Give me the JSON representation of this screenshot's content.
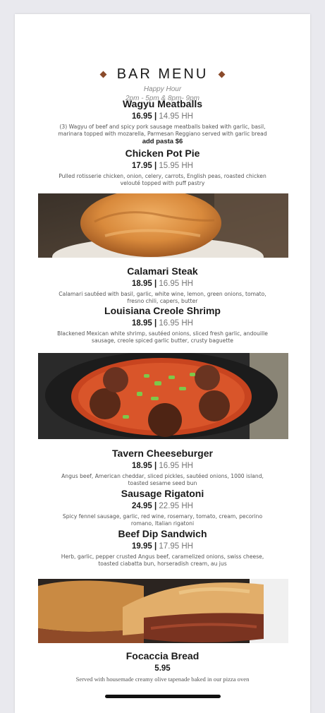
{
  "menu": {
    "title": "BAR MENU",
    "happy_hour_label": "Happy Hour",
    "happy_hour_times": "2pm - 5pm & 8pm- 9pm"
  },
  "items": [
    {
      "name": "Wagyu Meatballs",
      "price": "16.95",
      "separator": "|",
      "hh_price": "14.95 HH",
      "description": "(3) Wagyu of beef and spicy pork sausage meatballs baked with garlic, basil, marinara topped with mozarella, Parmesan Reggiano served with garlic bread",
      "extra": "add pasta $6"
    },
    {
      "name": "Chicken Pot Pie",
      "price": "17.95",
      "separator": "|",
      "hh_price": "15.95 HH",
      "description": "Pulled rotisserie chicken, onion, celery, carrots, English peas, roasted chicken velouté topped with puff pastry"
    },
    {
      "name": "Calamari Steak",
      "price": "18.95",
      "separator": "|",
      "hh_price": "16.95 HH",
      "description": "Calamari sautéed with basil, garlic, white wine, lemon, green onions, tomato, fresno chili, capers, butter"
    },
    {
      "name": "Louisiana Creole Shrimp",
      "price": "18.95",
      "separator": "|",
      "hh_price": "16.95 HH",
      "description": "Blackened Mexican white shrimp, sautéed onions, sliced fresh garlic, andouille sausage, creole spiced garlic butter, crusty baguette"
    },
    {
      "name": "Tavern Cheeseburger",
      "price": "18.95",
      "separator": "|",
      "hh_price": "16.95 HH",
      "description": "Angus beef, American cheddar, sliced pickles, sautéed onions, 1000 island, toasted sesame seed bun"
    },
    {
      "name": "Sausage Rigatoni",
      "price": "24.95",
      "separator": "|",
      "hh_price": "22.95 HH",
      "description": "Spicy fennel sausage, garlic, red wine, rosemary, tomato, cream, pecorino romano, Italian rigatoni"
    },
    {
      "name": "Beef Dip Sandwich",
      "price": "19.95",
      "separator": "|",
      "hh_price": "17.95 HH",
      "description": "Herb, garlic, pepper crusted Angus beef, caramelized onions, swiss cheese, toasted ciabatta bun, horseradish cream, au jus"
    },
    {
      "name": "Focaccia Bread",
      "price": "5.95",
      "description": "Served with housemade creamy olive tapenade baked in our pizza oven"
    }
  ],
  "colors": {
    "accent_diamond": "#8a4a2a",
    "hh_price": "#777777",
    "background": "#e9e9ee"
  }
}
